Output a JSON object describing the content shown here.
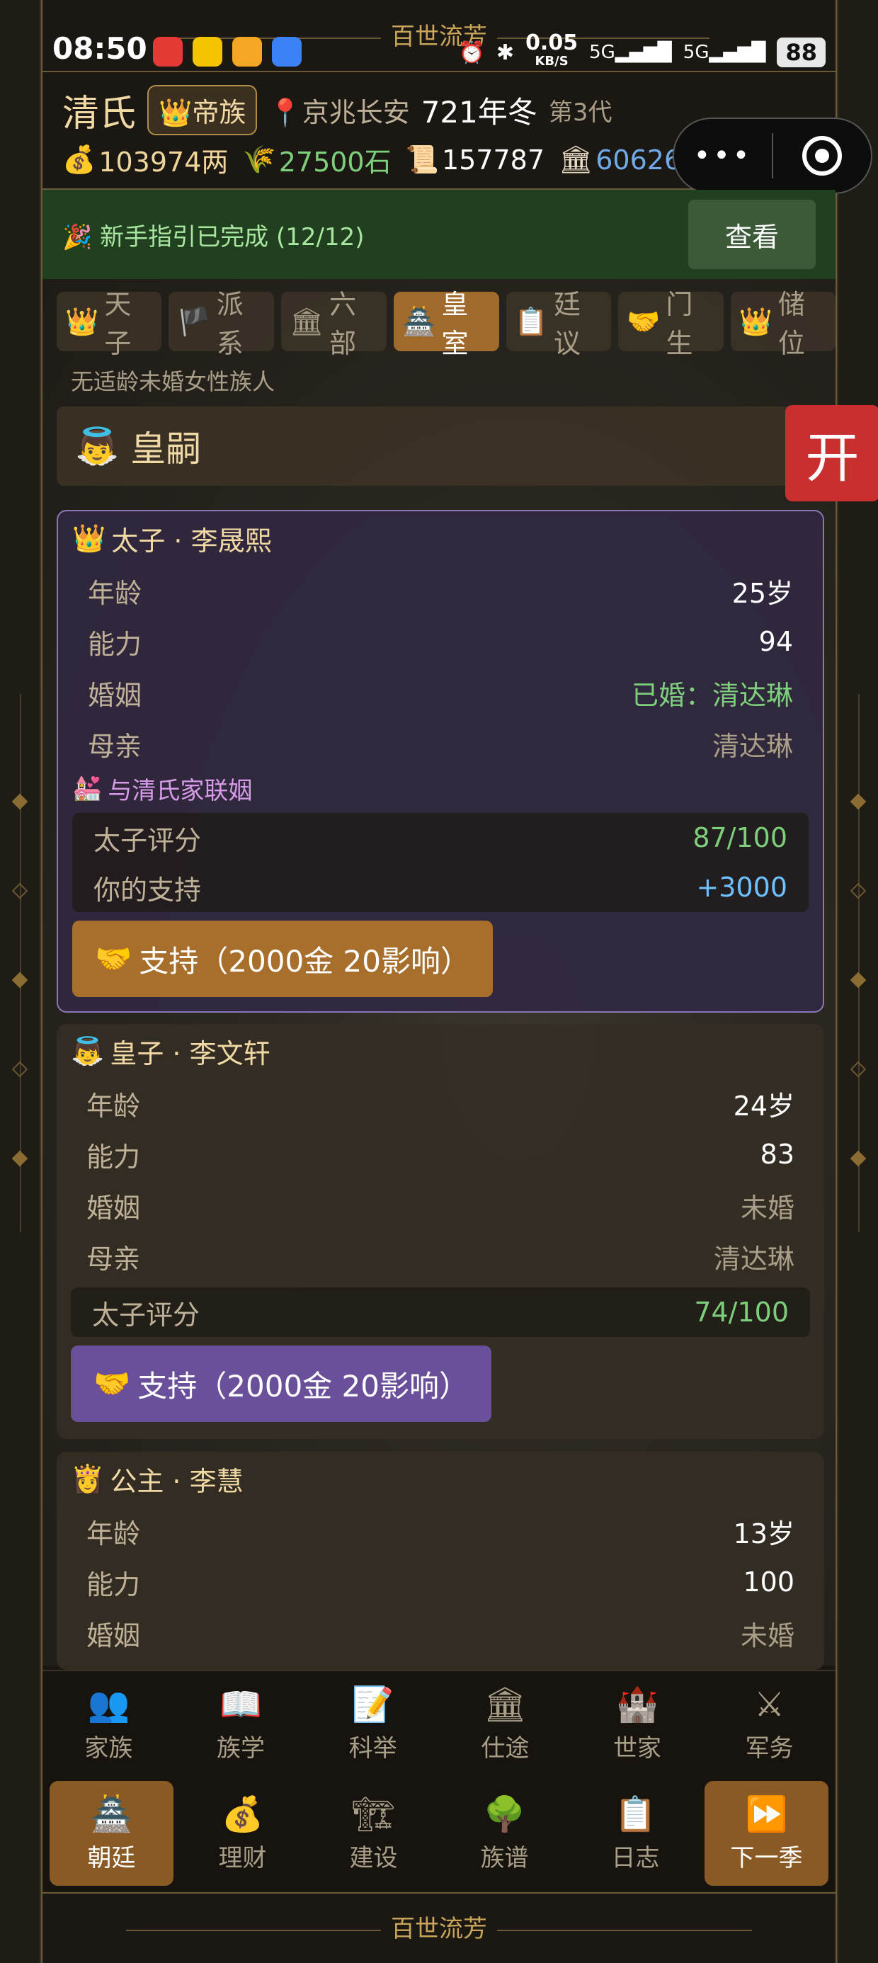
{
  "status_bar": {
    "time": "08:50",
    "app_title": "百世流芳",
    "net_speed": "0.05",
    "net_unit": "KB/S",
    "signal1": "5G",
    "signal2": "5G",
    "battery": "88"
  },
  "header": {
    "clan_name": "清氏",
    "rank": "帝族",
    "location": "京兆长安",
    "year": "721年冬",
    "generation": "第3代",
    "resources": {
      "silver": "103974两",
      "grain": "27500石",
      "scroll": "157787",
      "influence": "60626"
    }
  },
  "guide": {
    "text": "新手指引已完成 (12/12)",
    "button": "查看"
  },
  "tabs": [
    {
      "icon": "👑",
      "label": "天子"
    },
    {
      "icon": "🏴",
      "label": "派系"
    },
    {
      "icon": "🏛",
      "label": "六部"
    },
    {
      "icon": "🏯",
      "label": "皇室"
    },
    {
      "icon": "📋",
      "label": "廷议"
    },
    {
      "icon": "🤝",
      "label": "门生"
    },
    {
      "icon": "👑",
      "label": "储位"
    }
  ],
  "hint": "无适龄未婚女性族人",
  "section": {
    "icon": "👼",
    "title": "皇嗣"
  },
  "open_button": "开",
  "heirs": [
    {
      "title": "太子 · 李晟熙",
      "age_label": "年龄",
      "age": "25岁",
      "ability_label": "能力",
      "ability": "94",
      "marriage_label": "婚姻",
      "marriage": "已婚：清达琳",
      "mother_label": "母亲",
      "mother": "清达琳",
      "alliance": "与清氏家联姻",
      "score_label": "太子评分",
      "score": "87/100",
      "support_label": "你的支持",
      "support": "+3000",
      "button": "支持（2000金 20影响）"
    },
    {
      "title": "皇子 · 李文轩",
      "age_label": "年龄",
      "age": "24岁",
      "ability_label": "能力",
      "ability": "83",
      "marriage_label": "婚姻",
      "marriage": "未婚",
      "mother_label": "母亲",
      "mother": "清达琳",
      "score_label": "太子评分",
      "score": "74/100",
      "button": "支持（2000金 20影响）"
    },
    {
      "title": "公主 · 李慧",
      "age_label": "年龄",
      "age": "13岁",
      "ability_label": "能力",
      "ability": "100",
      "marriage_label": "婚姻",
      "marriage": "未婚"
    }
  ],
  "nav_row1": [
    {
      "icon": "👥",
      "label": "家族"
    },
    {
      "icon": "📖",
      "label": "族学"
    },
    {
      "icon": "📝",
      "label": "科举"
    },
    {
      "icon": "🏛",
      "label": "仕途"
    },
    {
      "icon": "🏰",
      "label": "世家"
    },
    {
      "icon": "⚔",
      "label": "军务"
    }
  ],
  "nav_row2": [
    {
      "icon": "🏯",
      "label": "朝廷"
    },
    {
      "icon": "💰",
      "label": "理财"
    },
    {
      "icon": "🏗",
      "label": "建设"
    },
    {
      "icon": "🌳",
      "label": "族谱"
    },
    {
      "icon": "📋",
      "label": "日志"
    },
    {
      "icon": "⏩",
      "label": "下一季"
    }
  ],
  "footer": "百世流芳"
}
